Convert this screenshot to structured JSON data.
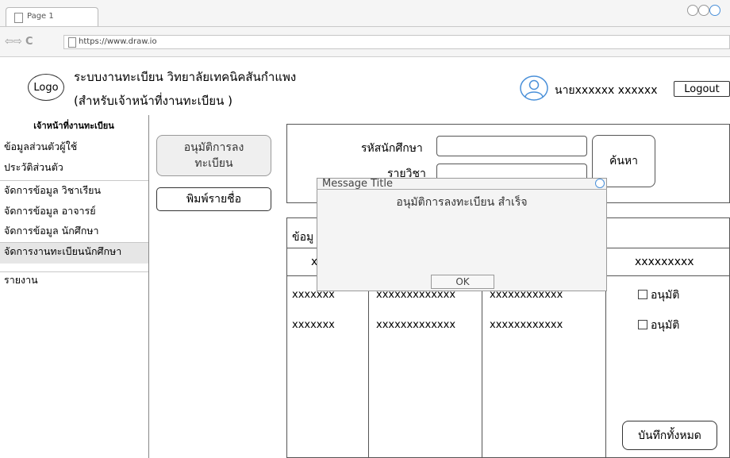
{
  "browser": {
    "tab_title": "Page 1",
    "url": "https://www.draw.io"
  },
  "header": {
    "logo": "Logo",
    "title_line1": "ระบบงานทะเบียน วิทยาลัยเทคนิคสันกำแพง",
    "title_line2": "(สำหรับเจ้าหน้าที่งานทะเบียน )",
    "user_name": "นายxxxxxx xxxxxx",
    "logout_label": "Logout"
  },
  "sidebar": {
    "heading": "เจ้าหน้าที่งานทะเบียน",
    "items": [
      {
        "label": "ข้อมูลส่วนตัวผู้ใช้"
      },
      {
        "label": "ประวัติส่วนตัว"
      },
      {
        "label": "จัดการข้อมูล วิชาเรียน"
      },
      {
        "label": "จัดการข้อมูล อาจารย์"
      },
      {
        "label": "จัดการข้อมูล นักศึกษา"
      },
      {
        "label": "จัดการงานทะเบียนนักศึกษา"
      },
      {
        "label": "รายงาน"
      }
    ]
  },
  "actions": {
    "approve_label": "อนุมัติการลงทะเบียน",
    "approve_line1": "อนุมัติการลง",
    "approve_line2": "ทะเบียน",
    "print_label": "พิมพ์รายชื่อ"
  },
  "search": {
    "student_id_label": "รหัสนักศึกษา",
    "student_id_value": "",
    "name_label": "รายวิชา",
    "name_value": "",
    "search_label": "ค้นหา"
  },
  "table": {
    "caption": "ข้อมู",
    "headers": [
      "x",
      "",
      "",
      "xxxxxxxxx"
    ],
    "rows": [
      {
        "c1": "xxxxxxx",
        "c2": "xxxxxxxxxxxxx",
        "c3": "xxxxxxxxxxxx",
        "approve_label": "อนุมัติ",
        "checked": false
      },
      {
        "c1": "xxxxxxx",
        "c2": "xxxxxxxxxxxxx",
        "c3": "xxxxxxxxxxxx",
        "approve_label": "อนุมัติ",
        "checked": false
      }
    ],
    "save_all_label": "บันทึกทั้งหมด"
  },
  "modal": {
    "title": "Message Title",
    "message": "อนุมัติการลงทะเบียน สำเร็จ",
    "ok_label": "OK"
  },
  "colors": {
    "accent": "#4a90d9",
    "sidebar_active": "#e6e6e6",
    "button_disabled_bg": "#efefef"
  }
}
